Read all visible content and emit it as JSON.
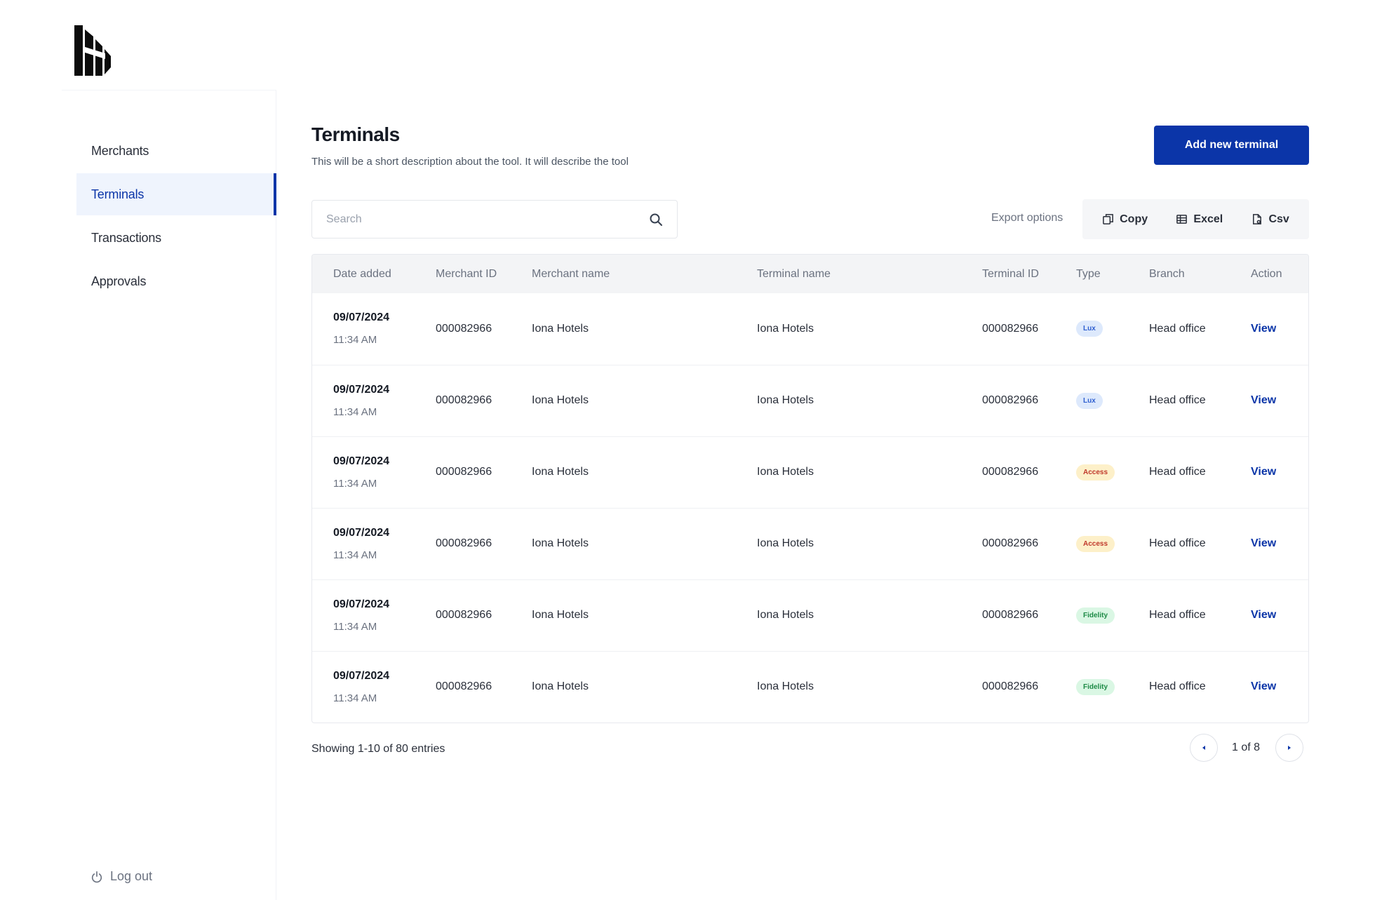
{
  "sidebar": {
    "items": [
      {
        "label": "Merchants"
      },
      {
        "label": "Terminals"
      },
      {
        "label": "Transactions"
      },
      {
        "label": "Approvals"
      }
    ],
    "logout_label": "Log out"
  },
  "page": {
    "title": "Terminals",
    "description": "This will be a short description about the tool. It will describe the tool",
    "add_button": "Add new terminal"
  },
  "search": {
    "placeholder": "Search"
  },
  "export": {
    "label": "Export options",
    "copy": "Copy",
    "excel": "Excel",
    "csv": "Csv"
  },
  "table": {
    "columns": [
      "Date added",
      "Merchant ID",
      "Merchant name",
      "Terminal name",
      "Terminal ID",
      "Type",
      "Branch",
      "Action"
    ],
    "rows": [
      {
        "date": "09/07/2024",
        "time": "11:34 AM",
        "merchant_id": "000082966",
        "merchant_name": "Iona Hotels",
        "terminal_name": "Iona Hotels",
        "terminal_id": "000082966",
        "type": "Lux",
        "branch": "Head office",
        "action": "View"
      },
      {
        "date": "09/07/2024",
        "time": "11:34 AM",
        "merchant_id": "000082966",
        "merchant_name": "Iona Hotels",
        "terminal_name": "Iona Hotels",
        "terminal_id": "000082966",
        "type": "Lux",
        "branch": "Head office",
        "action": "View"
      },
      {
        "date": "09/07/2024",
        "time": "11:34 AM",
        "merchant_id": "000082966",
        "merchant_name": "Iona Hotels",
        "terminal_name": "Iona Hotels",
        "terminal_id": "000082966",
        "type": "Access",
        "branch": "Head office",
        "action": "View"
      },
      {
        "date": "09/07/2024",
        "time": "11:34 AM",
        "merchant_id": "000082966",
        "merchant_name": "Iona Hotels",
        "terminal_name": "Iona Hotels",
        "terminal_id": "000082966",
        "type": "Access",
        "branch": "Head office",
        "action": "View"
      },
      {
        "date": "09/07/2024",
        "time": "11:34 AM",
        "merchant_id": "000082966",
        "merchant_name": "Iona Hotels",
        "terminal_name": "Iona Hotels",
        "terminal_id": "000082966",
        "type": "Fidelity",
        "branch": "Head office",
        "action": "View"
      },
      {
        "date": "09/07/2024",
        "time": "11:34 AM",
        "merchant_id": "000082966",
        "merchant_name": "Iona Hotels",
        "terminal_name": "Iona Hotels",
        "terminal_id": "000082966",
        "type": "Fidelity",
        "branch": "Head office",
        "action": "View"
      }
    ]
  },
  "badge_colors": {
    "Lux": {
      "bg": "#dde9fc",
      "fg": "#2f5fd0"
    },
    "Access": {
      "bg": "#fdf0c9",
      "fg": "#c0392b"
    },
    "Fidelity": {
      "bg": "#daf7e4",
      "fg": "#1c8a45"
    }
  },
  "footer": {
    "showing": "Showing 1-10 of 80 entries",
    "page_label": "1 of 8"
  },
  "colors": {
    "accent": "#0b35a8"
  },
  "icons": {
    "logo": "brand-logo",
    "search": "search-icon",
    "copy": "copy-icon",
    "excel": "table-icon",
    "csv": "file-icon",
    "logout": "power-icon",
    "prev": "chevron-left-icon",
    "next": "chevron-right-icon"
  }
}
